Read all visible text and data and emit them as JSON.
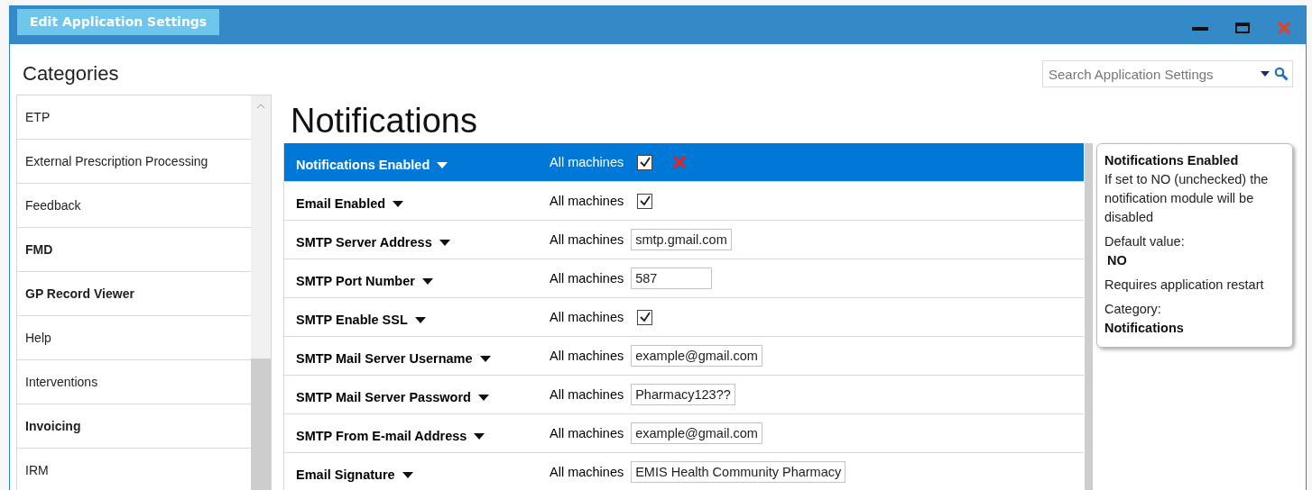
{
  "window": {
    "title": "Edit Application Settings"
  },
  "sidebar": {
    "title": "Categories",
    "items": [
      {
        "label": "ETP",
        "selected": false,
        "bold": false
      },
      {
        "label": "External Prescription Processing",
        "selected": false,
        "bold": false
      },
      {
        "label": "Feedback",
        "selected": false,
        "bold": false
      },
      {
        "label": "FMD",
        "selected": false,
        "bold": true
      },
      {
        "label": "GP Record Viewer",
        "selected": false,
        "bold": true
      },
      {
        "label": "Help",
        "selected": false,
        "bold": false
      },
      {
        "label": "Interventions",
        "selected": false,
        "bold": false
      },
      {
        "label": "Invoicing",
        "selected": false,
        "bold": true
      },
      {
        "label": "IRM",
        "selected": false,
        "bold": false
      }
    ]
  },
  "search": {
    "placeholder": "Search Application Settings"
  },
  "heading": "Notifications",
  "settings": [
    {
      "name": "Notifications Enabled",
      "scope": "All machines",
      "kind": "checkbox",
      "checked": true,
      "selected": true
    },
    {
      "name": "Email Enabled",
      "scope": "All machines",
      "kind": "checkbox",
      "checked": true,
      "selected": false
    },
    {
      "name": "SMTP Server Address",
      "scope": "All machines",
      "kind": "text",
      "value": "smtp.gmail.com",
      "selected": false
    },
    {
      "name": "SMTP Port Number",
      "scope": "All machines",
      "kind": "text",
      "value": "587",
      "selected": false
    },
    {
      "name": "SMTP Enable SSL",
      "scope": "All machines",
      "kind": "checkbox",
      "checked": true,
      "selected": false
    },
    {
      "name": "SMTP Mail Server Username",
      "scope": "All machines",
      "kind": "text",
      "value": "example@gmail.com",
      "selected": false
    },
    {
      "name": "SMTP Mail Server Password",
      "scope": "All machines",
      "kind": "text",
      "value": "Pharmacy123??",
      "selected": false
    },
    {
      "name": "SMTP From E-mail Address",
      "scope": "All machines",
      "kind": "text",
      "value": "example@gmail.com",
      "selected": false
    },
    {
      "name": "Email Signature",
      "scope": "All machines",
      "kind": "text",
      "value": "EMIS Health Community Pharmacy",
      "selected": false
    }
  ],
  "tooltip": {
    "title": "Notifications Enabled",
    "description": "If set to NO (unchecked) the notification module will be disabled",
    "default_label": "Default value:",
    "default_value": "NO",
    "restart_note": "Requires application restart",
    "category_label": "Category:",
    "category_value": "Notifications"
  }
}
